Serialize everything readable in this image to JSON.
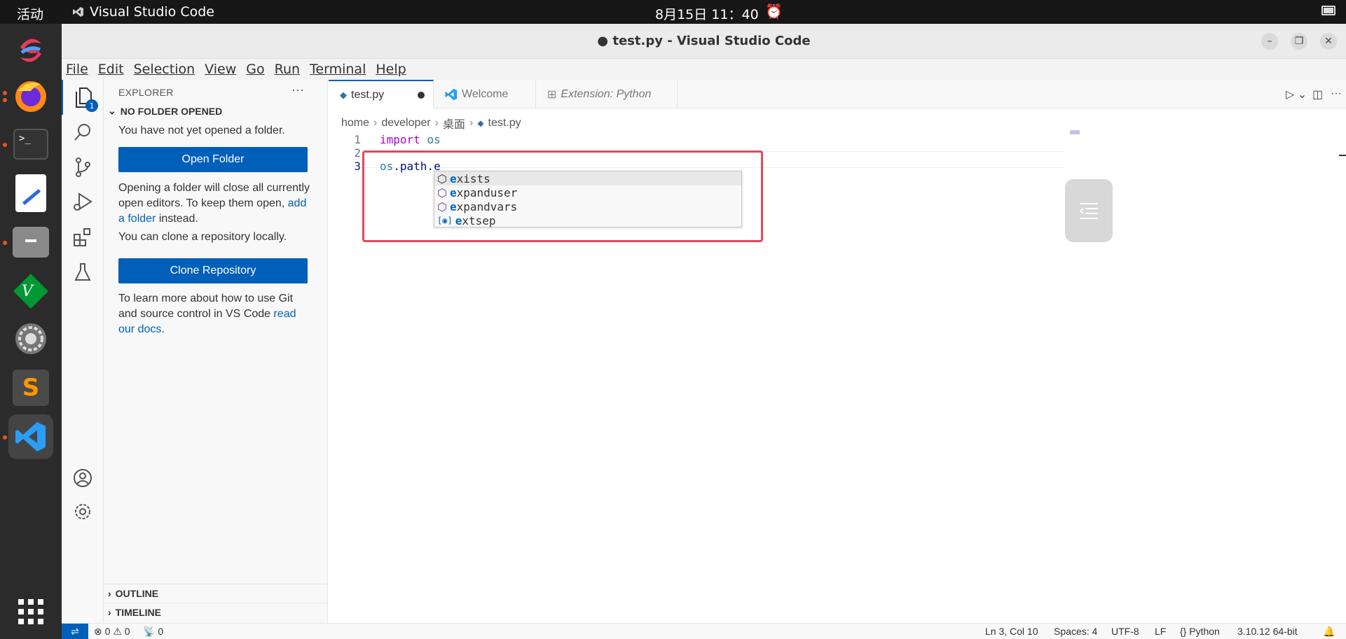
{
  "system": {
    "activities": "活动",
    "app_name": "Visual Studio Code",
    "clock": "8月15日 11：40"
  },
  "window": {
    "title": "● test.py - Visual Studio Code"
  },
  "menu": [
    "File",
    "Edit",
    "Selection",
    "View",
    "Go",
    "Run",
    "Terminal",
    "Help"
  ],
  "activity_bar": {
    "explorer_badge": "1"
  },
  "sidebar": {
    "title": "EXPLORER",
    "more": "···",
    "section": "NO FOLDER OPENED",
    "no_folder_text": "You have not yet opened a folder.",
    "open_folder_button": "Open Folder",
    "warning_text_before": "Opening a folder will close all currently open editors. To keep them open, ",
    "warning_link": "add a folder",
    "warning_text_after": " instead.",
    "clone_text": "You can clone a repository locally.",
    "clone_button": "Clone Repository",
    "git_text_before": "To learn more about how to use Git and source control in VS Code ",
    "git_link": "read our docs",
    "git_text_after": ".",
    "outline": "OUTLINE",
    "timeline": "TIMELINE"
  },
  "tabs": [
    {
      "label": "test.py",
      "active": true,
      "dirty": true
    },
    {
      "label": "Welcome",
      "active": false
    },
    {
      "label": "Extension: Python",
      "active": false
    }
  ],
  "breadcrumb": [
    "home",
    "developer",
    "桌面",
    "test.py"
  ],
  "code": {
    "line_numbers": [
      "1",
      "2",
      "3"
    ],
    "line1_kw": "import",
    "line1_mod": "os",
    "line3_mod": "os",
    "line3_rest": ".path.e"
  },
  "suggestions": [
    {
      "match": "e",
      "rest": "xists",
      "icon": "method-icon"
    },
    {
      "match": "e",
      "rest": "xpanduser",
      "icon": "method-icon"
    },
    {
      "match": "e",
      "rest": "xpandvars",
      "icon": "method-icon"
    },
    {
      "match": "e",
      "rest": "xtsep",
      "icon": "variable-icon"
    }
  ],
  "status": {
    "errors": "0",
    "warnings": "0",
    "ports": "0",
    "position": "Ln 3, Col 10",
    "spaces": "Spaces: 4",
    "encoding": "UTF-8",
    "eol": "LF",
    "language": "Python",
    "interpreter": "3.10.12 64-bit"
  },
  "colors": {
    "accent": "#005fb8",
    "highlight_box": "#e0495d"
  }
}
